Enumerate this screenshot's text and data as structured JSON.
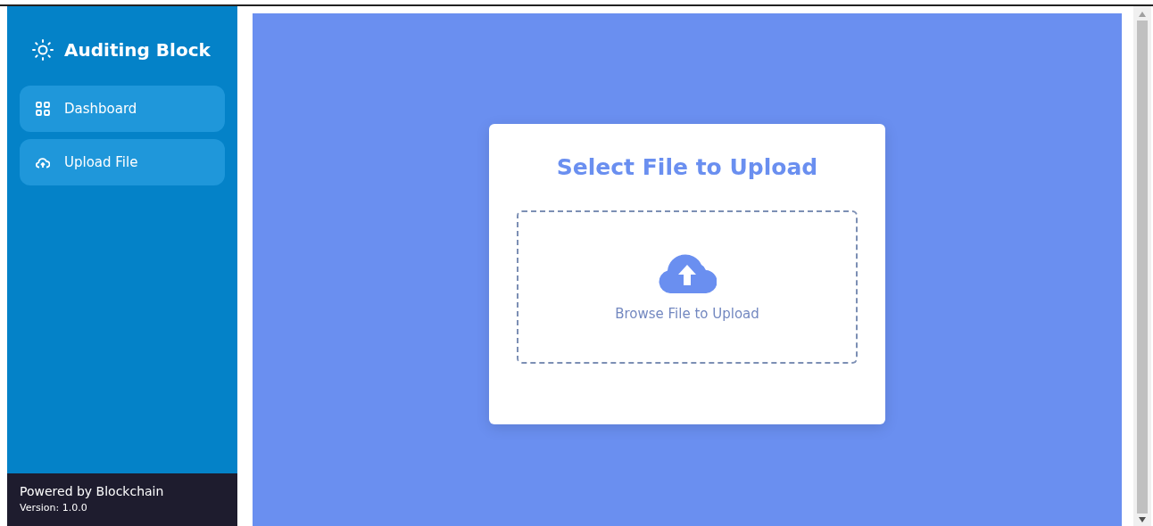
{
  "sidebar": {
    "brand": "Auditing Block",
    "items": [
      {
        "label": "Dashboard",
        "kind": "grid"
      },
      {
        "label": "Upload File",
        "kind": "upload"
      }
    ],
    "footer": {
      "powered": "Powered by Blockchain",
      "version": "Version: 1.0.0"
    }
  },
  "upload_card": {
    "title": "Select File to Upload",
    "dropzone_label": "Browse File to Upload"
  }
}
